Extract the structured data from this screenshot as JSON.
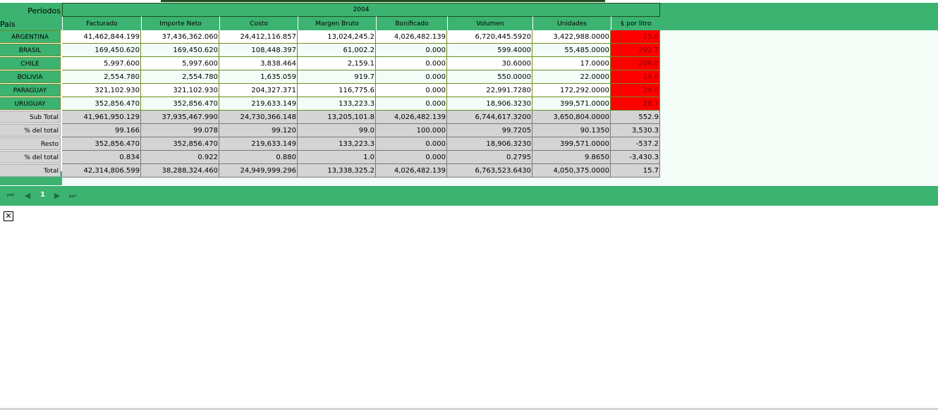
{
  "header": {
    "periodos_label": "Períodos",
    "pais_label": "Pais",
    "year": "2004",
    "columns": [
      "Facturado",
      "Importe Neto",
      "Costo",
      "Margen Bruto",
      "Bonificado",
      "Volumen",
      "Unidades",
      "$ por litro"
    ]
  },
  "countries": [
    {
      "name": "ARGENTINA",
      "values": [
        "41,462,844.199",
        "37,436,362.060",
        "24,412,116.857",
        "13,024,245.2",
        "4,026,482.139",
        "6,720,445.5920",
        "3,422,988.0000",
        "15.6"
      ]
    },
    {
      "name": "BRASIL",
      "values": [
        "169,450.620",
        "169,450.620",
        "108,448.397",
        "61,002.2",
        "0.000",
        "599.4000",
        "55,485.0000",
        "292.7"
      ]
    },
    {
      "name": "CHILE",
      "values": [
        "5,997.600",
        "5,997.600",
        "3,838.464",
        "2,159.1",
        "0.000",
        "30.6000",
        "17.0000",
        "206.0"
      ]
    },
    {
      "name": "BOLIVIA",
      "values": [
        "2,554.780",
        "2,554.780",
        "1,635.059",
        "919.7",
        "0.000",
        "550.0000",
        "22.0000",
        "14.6"
      ]
    },
    {
      "name": "PARAGUAY",
      "values": [
        "321,102.930",
        "321,102.930",
        "204,327.371",
        "116,775.6",
        "0.000",
        "22,991.7280",
        "172,292.0000",
        "24.0"
      ]
    },
    {
      "name": "URUGUAY",
      "values": [
        "352,856.470",
        "352,856.470",
        "219,633.149",
        "133,223.3",
        "0.000",
        "18,906.3230",
        "399,571.0000",
        "28.7"
      ]
    }
  ],
  "summary": [
    {
      "name": "Sub Total",
      "values": [
        "41,961,950.129",
        "37,935,467.990",
        "24,730,366.148",
        "13,205,101.8",
        "4,026,482.139",
        "6,744,617.3200",
        "3,650,804.0000",
        "552.9"
      ]
    },
    {
      "name": "% del total",
      "values": [
        "99.166",
        "99.078",
        "99.120",
        "99.0",
        "100.000",
        "99.7205",
        "90.1350",
        "3,530.3"
      ]
    },
    {
      "name": "Resto",
      "values": [
        "352,856.470",
        "352,856.470",
        "219,633.149",
        "133,223.3",
        "0.000",
        "18,906.3230",
        "399,571.0000",
        "-537.2"
      ]
    },
    {
      "name": "% del total",
      "values": [
        "0.834",
        "0.922",
        "0.880",
        "1.0",
        "0.000",
        "0.2795",
        "9.8650",
        "-3,430.3"
      ]
    },
    {
      "name": "Total",
      "values": [
        "42,314,806.599",
        "38,288,324.460",
        "24,949,999.296",
        "13,338,325.2",
        "4,026,482.139",
        "6,763,523.6430",
        "4,050,375.0000",
        "15.7"
      ]
    }
  ],
  "pager": {
    "first_icon": "first-page-icon",
    "prev_icon": "prev-page-icon",
    "current_page": "1",
    "next_icon": "next-page-icon",
    "last_icon": "last-page-icon"
  },
  "close_icon": "close-icon",
  "colors": {
    "header_green": "#3cb371",
    "highlight_red": "#ff0000",
    "summary_gray": "#d4d4d4",
    "light_row": "#f3fcf6"
  }
}
